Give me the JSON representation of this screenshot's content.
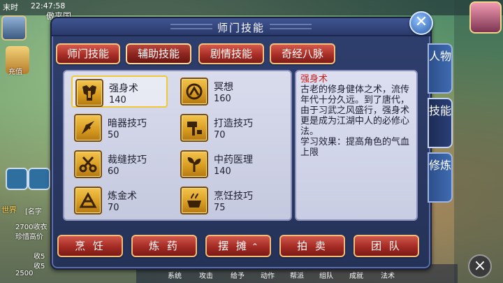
{
  "hud": {
    "time": "末时",
    "clock": "22:47:58",
    "player_name": "傲来国",
    "charge_label": "充值",
    "world_label": "世界",
    "chat_lines": [
      "[名字",
      "2700收衣",
      "珍惜高价",
      "收5",
      "收5",
      "2500"
    ],
    "bottom_labels": [
      "系统",
      "攻击",
      "给予",
      "动作",
      "帮派",
      "组队",
      "成就",
      "法术"
    ]
  },
  "modal": {
    "title": "师门技能",
    "close_symbol": "✕"
  },
  "tabs": [
    {
      "label": "师门技能",
      "active": false
    },
    {
      "label": "辅助技能",
      "active": true
    },
    {
      "label": "剧情技能",
      "active": false
    },
    {
      "label": "奇经八脉",
      "active": false
    }
  ],
  "skills": [
    {
      "name": "强身术",
      "level": "140",
      "icon": "armor-icon",
      "selected": true
    },
    {
      "name": "冥想",
      "level": "160",
      "icon": "meditation-icon",
      "selected": false
    },
    {
      "name": "暗器技巧",
      "level": "50",
      "icon": "dart-icon",
      "selected": false
    },
    {
      "name": "打造技巧",
      "level": "70",
      "icon": "hammer-icon",
      "selected": false
    },
    {
      "name": "裁缝技巧",
      "level": "60",
      "icon": "scissors-icon",
      "selected": false
    },
    {
      "name": "中药医理",
      "level": "140",
      "icon": "herb-icon",
      "selected": false
    },
    {
      "name": "炼金术",
      "level": "70",
      "icon": "alchemy-icon",
      "selected": false
    },
    {
      "name": "烹饪技巧",
      "level": "75",
      "icon": "cooking-icon",
      "selected": false
    }
  ],
  "description": {
    "title": "强身术",
    "body": "古老的修身健体之术，流传年代十分久远。到了唐代，由于习武之风盛行，强身术更是成为江湖中人的必修心法。",
    "effect": "学习效果：提高角色的气血上限"
  },
  "side_tabs": [
    {
      "label": "人物",
      "active": false
    },
    {
      "label": "技能",
      "active": true
    },
    {
      "label": "修炼",
      "active": false
    }
  ],
  "actions": [
    {
      "label": "烹 饪"
    },
    {
      "label": "炼 药"
    },
    {
      "label": "摆 摊",
      "caret": "⌃"
    },
    {
      "label": "拍 卖"
    },
    {
      "label": "团 队"
    }
  ],
  "colors": {
    "accent_red": "#a92e27",
    "selected_border": "#f0c93a",
    "description_title": "#d01f1f"
  }
}
